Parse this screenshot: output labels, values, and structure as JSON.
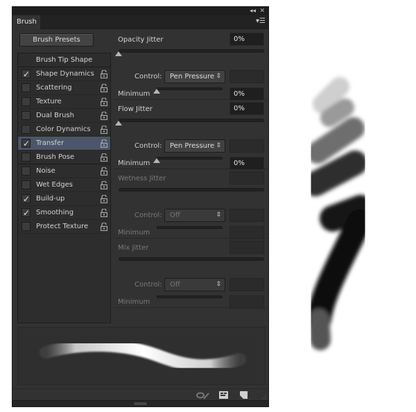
{
  "window": {
    "collapse_icon": "double-chevron-left-icon",
    "close_icon": "close-icon"
  },
  "tab": {
    "label": "Brush",
    "menu_icon": "panel-menu-icon"
  },
  "brush_presets_button": "Brush Presets",
  "list": {
    "header": "Brush Tip Shape",
    "items": [
      {
        "label": "Shape Dynamics",
        "checked": true,
        "selected": false
      },
      {
        "label": "Scattering",
        "checked": false,
        "selected": false
      },
      {
        "label": "Texture",
        "checked": false,
        "selected": false
      },
      {
        "label": "Dual Brush",
        "checked": false,
        "selected": false
      },
      {
        "label": "Color Dynamics",
        "checked": false,
        "selected": false
      },
      {
        "label": "Transfer",
        "checked": true,
        "selected": true
      },
      {
        "label": "Brush Pose",
        "checked": false,
        "selected": false
      },
      {
        "label": "Noise",
        "checked": false,
        "selected": false
      },
      {
        "label": "Wet Edges",
        "checked": false,
        "selected": false
      },
      {
        "label": "Build-up",
        "checked": true,
        "selected": false
      },
      {
        "label": "Smoothing",
        "checked": true,
        "selected": false
      },
      {
        "label": "Protect Texture",
        "checked": false,
        "selected": false
      }
    ],
    "check_glyph": "✓"
  },
  "sections": [
    {
      "title": "Opacity Jitter",
      "value": "0%",
      "control_label": "Control:",
      "control_value": "Pen Pressure",
      "minimum_label": "Minimum",
      "minimum_value": "0%",
      "enabled": true,
      "jitter_fraction": 0,
      "minimum_fraction": 0
    },
    {
      "title": "Flow Jitter",
      "value": "0%",
      "control_label": "Control:",
      "control_value": "Pen Pressure",
      "minimum_label": "Minimum",
      "minimum_value": "0%",
      "enabled": true,
      "jitter_fraction": 0,
      "minimum_fraction": 0
    },
    {
      "title": "Wetness Jitter",
      "value": "",
      "control_label": "Control:",
      "control_value": "Off",
      "minimum_label": "Minimum",
      "minimum_value": "",
      "enabled": false
    },
    {
      "title": "Mix Jitter",
      "value": "",
      "control_label": "Control:",
      "control_value": "Off",
      "minimum_label": "Minimum",
      "minimum_value": "",
      "enabled": false
    }
  ],
  "select_arrow_glyph": "⇕",
  "footer": {
    "icons": [
      "toggle-live-tip-preview-icon",
      "open-preset-manager-icon",
      "create-new-brush-icon"
    ]
  },
  "colors": {
    "panel_bg": "#323232",
    "selected_row": "#4b566b",
    "text": "#d6d6d6"
  }
}
